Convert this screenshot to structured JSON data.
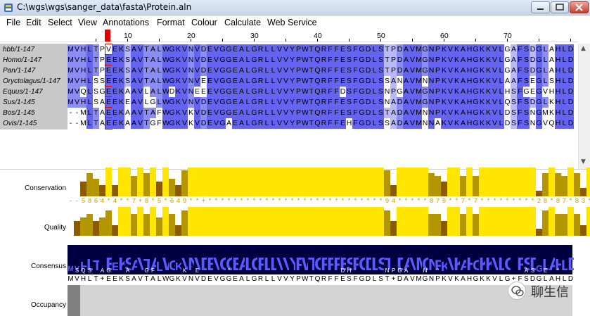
{
  "window": {
    "title": "C:\\wgs\\wgs\\sanger_data\\fasta\\Protein.aln",
    "app_icon": "jalview-icon",
    "controls": [
      "minimize-icon",
      "maximize-icon",
      "close-icon"
    ]
  },
  "menu": [
    "File",
    "Edit",
    "Select",
    "View",
    "Annotations",
    "Format",
    "Colour",
    "Calculate",
    "Web Service"
  ],
  "ruler": {
    "labels": [
      "10",
      "20",
      "30",
      "40",
      "50",
      "60",
      "70"
    ],
    "selected_column": 7
  },
  "colors": {
    "dark_identity": "#6464f0",
    "mid_identity": "#8c8cf5",
    "light_identity": "#b9b9f8",
    "annotation_yellow": "#ffe600",
    "annotation_olive": "#b49600",
    "annotation_brown": "#8c5a00",
    "consensus_bg": "#000040",
    "selection_red": "#e00000"
  },
  "sequences": [
    {
      "name": "hbb/1-147",
      "residues": "MVHLTPVEKSAVTALWGKVNVDEVGGEALGRLLVVYPWTQRFFESFGDLSTPDAVMGNPKVKAHGKKVLGAFSDGLAHLD"
    },
    {
      "name": "Homo/1-147",
      "residues": "MVHLTPEEKSAVTALWGKVNVDEVGGEALGRLLVVYPWTQRFFESFGDLSTPDAVMGNPKVKAHGKKVLGAFSDGLAHLD"
    },
    {
      "name": "Pan/1-147",
      "residues": "MVHLTPEEKSAVTALWGKVNVDEVGGEALGRLLVVYPWTQRFFESFGDLSTPDAVMGNPKVKAHGKKVLGAFSDGLAHLD"
    },
    {
      "name": "Oryctolagus/1-147",
      "residues": "MVHLSSEEKSAVTALWGKVNVEEVGGEALGRLLVVYPWTQRFFESFGDLSSANAVMNNPKVKAHGKKVLAAFSEGLSHLD"
    },
    {
      "name": "Equus/1-147",
      "residues": "MVQLSGEEKAAVLALWDKVNEEEVGGEALGRLLVVYPWTQRFFDSFGDLSNPGAVMGNPKVKAHGKKVLHSFGEGVHHLD"
    },
    {
      "name": "Sus/1-145",
      "residues": "MVHLSAEEKEAVLGLWGKVNVDEVGGEALGRLLVVYPWTQRFFESFGDLSNADAVMGNPKVKAHGKKVLQSFSDGLKHLD"
    },
    {
      "name": "Bos/1-145",
      "residues": "--MLTAEEKAAVTAFWGKVKVDEVGGEALGRLLVVYPWTQRFFESFGDLSTADAVMNNPKVKAHGKKVLDSFSNGMKHLD"
    },
    {
      "name": "Ovis/1-145",
      "residues": "--MLTAEEKAAVTGFWGKVKVDEVGAEALGRLLVVYPWTQRFFEHFGDLSSADAVMNNAKVKAHGKKVLDSFSNGVQHLD"
    }
  ],
  "annotations": {
    "labels": [
      "Conservation",
      "Quality",
      "Consensus",
      "Occupancy"
    ],
    "conservation_symbols": "--5864*4**7+8*5*649**+****************************94*****875**7*7*********28*87*83****",
    "conservation_values": [
      0,
      0,
      5,
      8,
      6,
      4,
      10,
      4,
      10,
      10,
      7,
      10,
      8,
      10,
      5,
      10,
      6,
      4,
      9,
      10,
      10,
      10,
      10,
      10,
      10,
      10,
      10,
      10,
      10,
      10,
      10,
      10,
      10,
      10,
      10,
      10,
      10,
      10,
      10,
      10,
      10,
      10,
      10,
      10,
      10,
      10,
      10,
      10,
      10,
      10,
      9,
      4,
      10,
      10,
      10,
      10,
      10,
      8,
      7,
      5,
      10,
      10,
      7,
      10,
      7,
      10,
      10,
      10,
      10,
      10,
      10,
      10,
      10,
      10,
      2,
      8,
      10,
      8,
      7,
      10,
      8,
      3,
      10,
      10,
      10
    ],
    "quality_values": [
      0,
      4,
      5,
      6,
      4,
      5,
      7,
      3,
      8,
      8,
      6,
      8,
      6,
      8,
      5,
      8,
      6,
      3,
      7,
      8,
      8,
      8,
      8,
      8,
      8,
      8,
      8,
      8,
      8,
      8,
      8,
      8,
      8,
      8,
      8,
      8,
      8,
      8,
      8,
      8,
      8,
      8,
      8,
      8,
      8,
      8,
      8,
      8,
      8,
      8,
      7,
      4,
      8,
      8,
      8,
      8,
      8,
      6,
      6,
      4,
      8,
      8,
      6,
      8,
      6,
      8,
      8,
      8,
      8,
      8,
      8,
      8,
      8,
      8,
      2,
      7,
      8,
      6,
      6,
      8,
      6,
      3,
      8,
      8,
      8
    ],
    "consensus": "MVHLT+EEKSAVTALWGKVNVDEVGGEALGRLLVVYPWTQRFFESFGDLST+DAVMGNPKVKAHGKKVLG+FSDGLAHLD",
    "consensus_sub": [
      " ",
      "S",
      "Q",
      "S",
      " ",
      "A",
      "G",
      " ",
      " ",
      "A",
      " ",
      " ",
      "G",
      "F",
      " ",
      " ",
      " ",
      " ",
      "K",
      " ",
      "E",
      " ",
      " ",
      " ",
      " ",
      "^",
      " ",
      " ",
      " ",
      " ",
      " ",
      " ",
      " ",
      " ",
      " ",
      " ",
      " ",
      " ",
      " ",
      " ",
      " ",
      " ",
      " ",
      "D",
      "H",
      " ",
      " ",
      " ",
      " ",
      " ",
      "N",
      "P",
      "G",
      "A",
      " ",
      " ",
      "N",
      " ",
      "^",
      " ",
      " ",
      " ",
      " ",
      " ",
      " ",
      " ",
      " ",
      " ",
      " ",
      " ",
      " ",
      " ",
      "A",
      "S",
      " ",
      "E",
      " ",
      "^",
      " ",
      " ",
      " ",
      " "
    ],
    "occupancy_fraction": 0.97
  },
  "watermark": {
    "text": "聊生信",
    "icon": "wechat-logo-icon"
  }
}
